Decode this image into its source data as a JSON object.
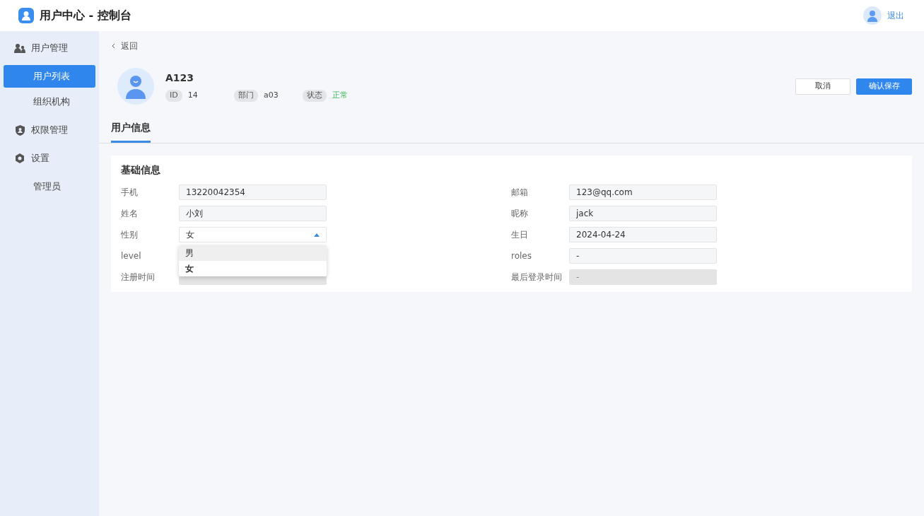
{
  "header": {
    "title": "用户中心 - 控制台",
    "logout": "退出"
  },
  "sidebar": [
    {
      "label": "用户管理",
      "selected": false,
      "children": [
        {
          "label": "用户列表",
          "selected": true
        },
        {
          "label": "组织机构",
          "selected": false
        }
      ]
    },
    {
      "label": "权限管理",
      "selected": false
    },
    {
      "label": "设置",
      "selected": false,
      "children": [
        {
          "label": "管理员",
          "selected": false
        }
      ]
    }
  ],
  "back": "返回",
  "profile": {
    "name": "A123",
    "meta": [
      {
        "label": "ID",
        "value": "14",
        "kind": "plain"
      },
      {
        "label": "部门",
        "value": "a03",
        "kind": "plain"
      },
      {
        "label": "状态",
        "value": "正常",
        "kind": "status"
      }
    ]
  },
  "buttons": [
    {
      "label": "取消",
      "kind": "secondary"
    },
    {
      "label": "确认保存",
      "kind": "primary"
    }
  ],
  "tabs": [
    {
      "label": "用户信息",
      "selected": true
    }
  ],
  "section": {
    "title": "基础信息",
    "left": [
      {
        "label": "手机",
        "value": "13220042354",
        "kind": "input"
      },
      {
        "label": "姓名",
        "value": "小刘",
        "kind": "input"
      },
      {
        "label": "性别",
        "value": "女",
        "kind": "select",
        "expanded": true,
        "options": [
          {
            "label": "男",
            "selected": false,
            "hovered": true
          },
          {
            "label": "女",
            "selected": true,
            "hovered": false
          }
        ]
      },
      {
        "label": "level"
      },
      {
        "label": "注册时间",
        "kind": "locked"
      }
    ],
    "right": [
      {
        "label": "邮箱",
        "value": "123@qq.com",
        "kind": "input"
      },
      {
        "label": "昵称",
        "value": "jack",
        "kind": "input"
      },
      {
        "label": "生日",
        "value": "2024-04-24",
        "kind": "input"
      },
      {
        "label": "roles",
        "value": "-",
        "kind": "input"
      },
      {
        "label": "最后登录时间",
        "value": "-",
        "kind": "locked"
      }
    ]
  }
}
